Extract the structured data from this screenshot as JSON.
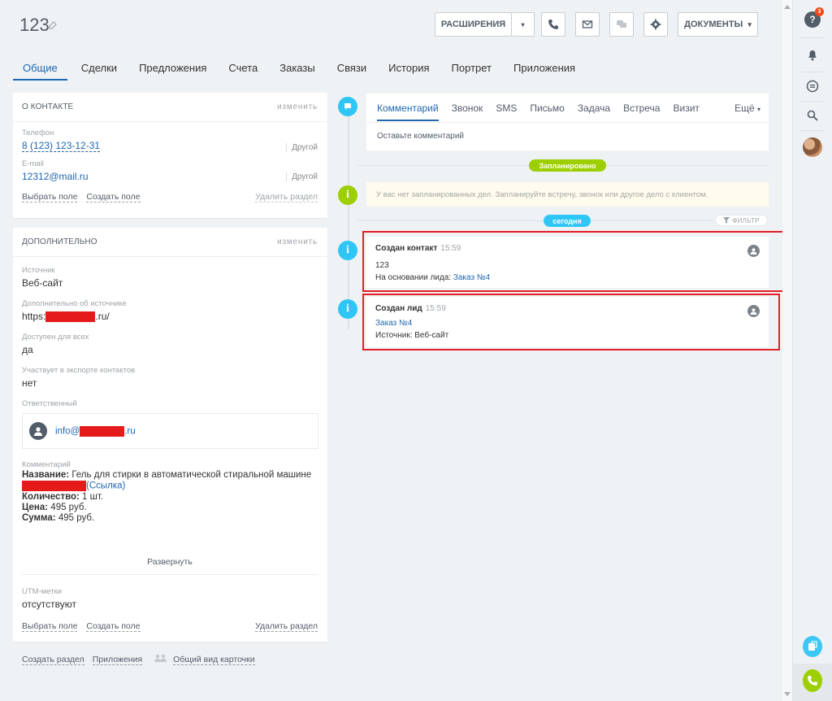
{
  "header": {
    "title": "123",
    "buttons": {
      "extensions": "РАСШИРЕНИЯ",
      "documents": "ДОКУМЕНТЫ"
    }
  },
  "tabs": [
    "Общие",
    "Сделки",
    "Предложения",
    "Счета",
    "Заказы",
    "Связи",
    "История",
    "Портрет",
    "Приложения"
  ],
  "contact_panel": {
    "title": "О КОНТАКТЕ",
    "edit": "изменить",
    "phone_label": "Телефон",
    "phone_value": "8 (123) 123-12-31",
    "phone_type": "Другой",
    "email_label": "E-mail",
    "email_value": "12312@mail.ru",
    "email_type": "Другой",
    "select_field": "Выбрать поле",
    "create_field": "Создать поле",
    "delete_section": "Удалить раздел"
  },
  "extra_panel": {
    "title": "ДОПОЛНИТЕЛЬНО",
    "edit": "изменить",
    "source_label": "Источник",
    "source_value": "Веб-сайт",
    "source_more_label": "Дополнительно об источнике",
    "source_more_prefix": "https:",
    "source_more_suffix": ".ru/",
    "available_label": "Доступен для всех",
    "available_value": "да",
    "export_label": "Участвует в экспорте контактов",
    "export_value": "нет",
    "responsible_label": "Ответственный",
    "responsible_prefix": "info@",
    "responsible_suffix": ".ru",
    "comment_label": "Комментарий",
    "comment_name_key": "Название:",
    "comment_name_value": " Гель для стирки в автоматической стиральной машине",
    "comment_link": "(Ссылка)",
    "comment_qty_key": "Количество:",
    "comment_qty_value": " 1 шт.",
    "comment_price_key": "Цена:",
    "comment_price_value": " 495 руб.",
    "comment_sum_key": "Сумма:",
    "comment_sum_value": " 495 руб.",
    "expand": "Развернуть",
    "utm_label": "UTM-метки",
    "utm_value": "отсутствуют",
    "select_field": "Выбрать поле",
    "create_field": "Создать поле",
    "delete_section": "Удалить раздел"
  },
  "bottom_links": {
    "create_section": "Создать раздел",
    "apps": "Приложения",
    "common_view": "Общий вид карточки"
  },
  "editor": {
    "tabs": [
      "Комментарий",
      "Звонок",
      "SMS",
      "Письмо",
      "Задача",
      "Встреча",
      "Визит"
    ],
    "more": "Ещё",
    "placeholder": "Оставьте комментарий"
  },
  "timeline": {
    "planned_label": "Запланировано",
    "planned_notice": "У вас нет запланированных дел. Запланируйте встречу, звонок или другое дело с клиентом.",
    "today_label": "сегодня",
    "filter": "ФИЛЬТР",
    "events": [
      {
        "title": "Создан контакт",
        "time": "15:59",
        "line1": "123",
        "line2_prefix": "На основании лида: ",
        "line2_link": "Заказ №4"
      },
      {
        "title": "Создан лид",
        "time": "15:59",
        "line1_link": "Заказ №4",
        "line2": "Источник: Веб-сайт"
      }
    ]
  },
  "rightbar": {
    "help_badge": "3"
  },
  "colors": {
    "accent": "#2067b0",
    "timeline_blue": "#2fc6f6",
    "timeline_green": "#9dcf00",
    "highlight_red": "#e41e26",
    "redaction": "#e51b1b"
  }
}
